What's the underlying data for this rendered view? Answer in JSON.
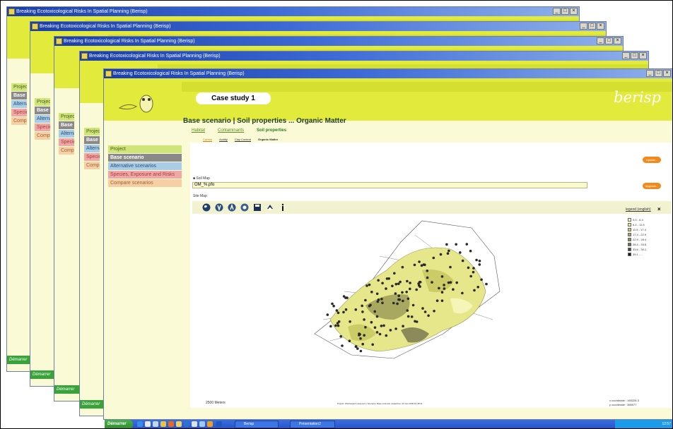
{
  "window_title": "Breaking Ecotoxicological Risks In Spatial Planning (Berisp)",
  "window_controls": [
    "_",
    "□",
    "×"
  ],
  "case_study_label": "Case study 1",
  "logo_text": "berisp",
  "page_heading": "Base scenario | Soil properties ... Organic Matter",
  "sidebar": {
    "items": [
      {
        "label": "Project"
      },
      {
        "label": "Base scenario"
      },
      {
        "label": "Alternative scenarios"
      },
      {
        "label": "Species, Exposure and Risks"
      },
      {
        "label": "Compare scenarios"
      }
    ],
    "truncated": [
      "Project",
      "Base s",
      "Alterna",
      "Specie",
      "Compa"
    ]
  },
  "tabs": [
    "Habitat",
    "Contaminants",
    "Soil properties"
  ],
  "subtabs": [
    "Carbon",
    "Acidity",
    "Clay Content",
    "Organic Matter"
  ],
  "orange_buttons": [
    "Update...",
    "Upgrade..."
  ],
  "soil_map_field_label": "Soil Map",
  "soil_map_value": "OM_%.pfo",
  "map_section_label": "Site Map",
  "legend": {
    "header": "legend (english)",
    "close": "×",
    "entries": [
      {
        "label": "0.0 - 6.4",
        "color": "#f5f5b8"
      },
      {
        "label": "6.4 - 11.5",
        "color": "#e6e68a"
      },
      {
        "label": "11.5 - 17.4",
        "color": "#cccc66"
      },
      {
        "label": "17.4 - 22.9",
        "color": "#a8a860"
      },
      {
        "label": "22.9 - 28.4",
        "color": "#8a8a5a"
      },
      {
        "label": "28.4 - 33.6",
        "color": "#6e6e50"
      },
      {
        "label": "33.6 - 39.1",
        "color": "#4a4a3c"
      },
      {
        "label": "39.1 - ...",
        "color": "#1a1a1a"
      }
    ]
  },
  "scale_text": "2500 Meters",
  "status_text": "Project: Werkwaard Lasserent | Scenario: Base scenario | date/time: 20 Jan 2009 10:48:41",
  "coords": {
    "x_label": "x coordinate",
    "x_value": ": 165228.3",
    "y_label": "y coordinate",
    "y_value": ": 385077"
  },
  "taskbar": {
    "start_label": "Démarrer",
    "buttons": [
      "Berisp",
      "Présentation2"
    ],
    "clock": "12:57"
  },
  "colors": {
    "banner_yellow": "#e2ea3c",
    "background": "#fafad6",
    "titlebar_blue": "#1b3fa8",
    "orange": "#f08a1c"
  }
}
